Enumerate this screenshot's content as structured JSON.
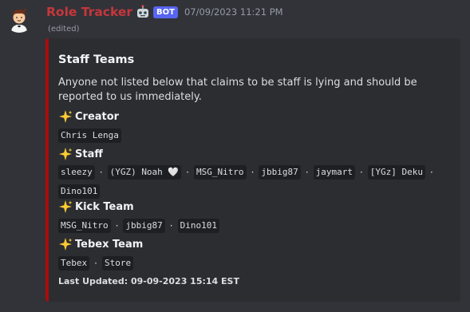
{
  "message": {
    "username": "Role Tracker",
    "robot_emoji": "🤖",
    "bot_tag": "BOT",
    "timestamp": "07/09/2023 11:21 PM",
    "edited": "(edited)"
  },
  "embed": {
    "accent_color": "#ab0c0c",
    "title": "Staff Teams",
    "description": "Anyone not listed below that claims to be staff is lying and should be reported to us immediately.",
    "sections": [
      {
        "title": "Creator",
        "members": [
          "Chris Lenga"
        ]
      },
      {
        "title": "Staff",
        "members": [
          "sleezy",
          "(YGZ) Noah 🤍",
          "MSG_Nitro",
          "jbbig87",
          "jaymart",
          "[YGz] Deku",
          "Dino101"
        ]
      },
      {
        "title": "Kick Team",
        "members": [
          "MSG_Nitro",
          "jbbig87",
          "Dino101"
        ]
      },
      {
        "title": "Tebex Team",
        "members": [
          "Tebex",
          "Store"
        ]
      }
    ],
    "separator": "·",
    "footer": "Last Updated: 09-09-2023 15:14 EST"
  }
}
